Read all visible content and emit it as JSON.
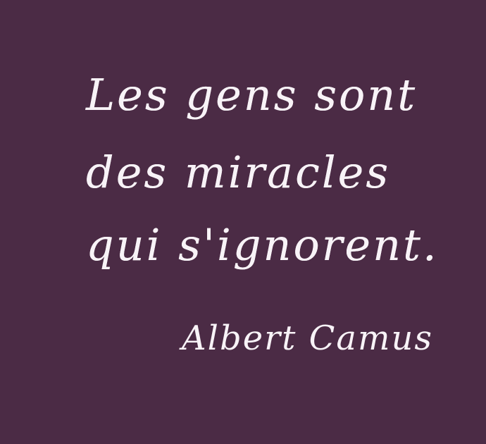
{
  "quote": {
    "lines": [
      "Les gens sont",
      "des miracles",
      "qui s'ignorent."
    ],
    "author": "Albert Camus"
  },
  "colors": {
    "background": "#4b2b45",
    "text": "#f8f3f7"
  }
}
